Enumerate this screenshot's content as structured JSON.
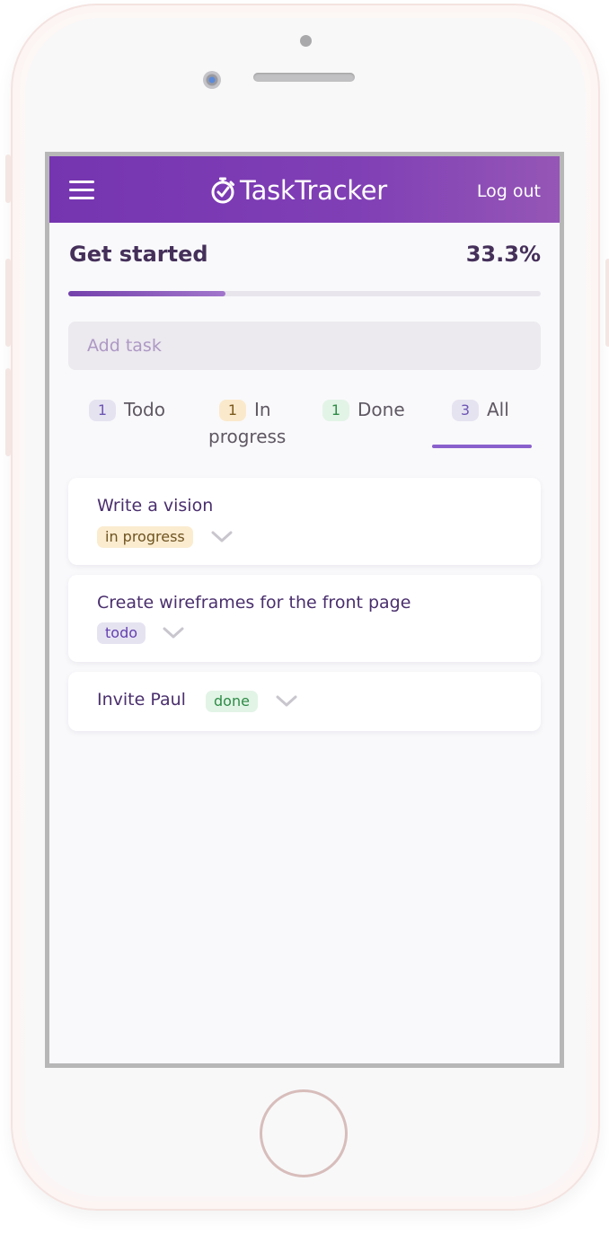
{
  "app": {
    "name": "TaskTracker",
    "logout_label": "Log out"
  },
  "progress": {
    "title": "Get started",
    "percent_label": "33.3%",
    "fraction": 0.333
  },
  "add_task": {
    "placeholder": "Add task",
    "value": ""
  },
  "tabs": [
    {
      "count": "1",
      "label": "Todo"
    },
    {
      "count": "1",
      "label_line1": "In",
      "label_line2": "progress"
    },
    {
      "count": "1",
      "label": "Done"
    },
    {
      "count": "3",
      "label": "All",
      "active": true
    }
  ],
  "tasks": [
    {
      "title": "Write a vision",
      "status": "in progress"
    },
    {
      "title": "Create wireframes for the front page",
      "status": "todo"
    },
    {
      "title": "Invite Paul",
      "status": "done"
    }
  ],
  "colors": {
    "header_start": "#7535b0",
    "header_end": "#9556b6",
    "accent": "#8a60cc",
    "text_dark": "#45305a"
  },
  "icons": {
    "menu": "hamburger-menu-icon",
    "logo": "stopwatch-icon",
    "expand": "chevron-down-icon"
  }
}
